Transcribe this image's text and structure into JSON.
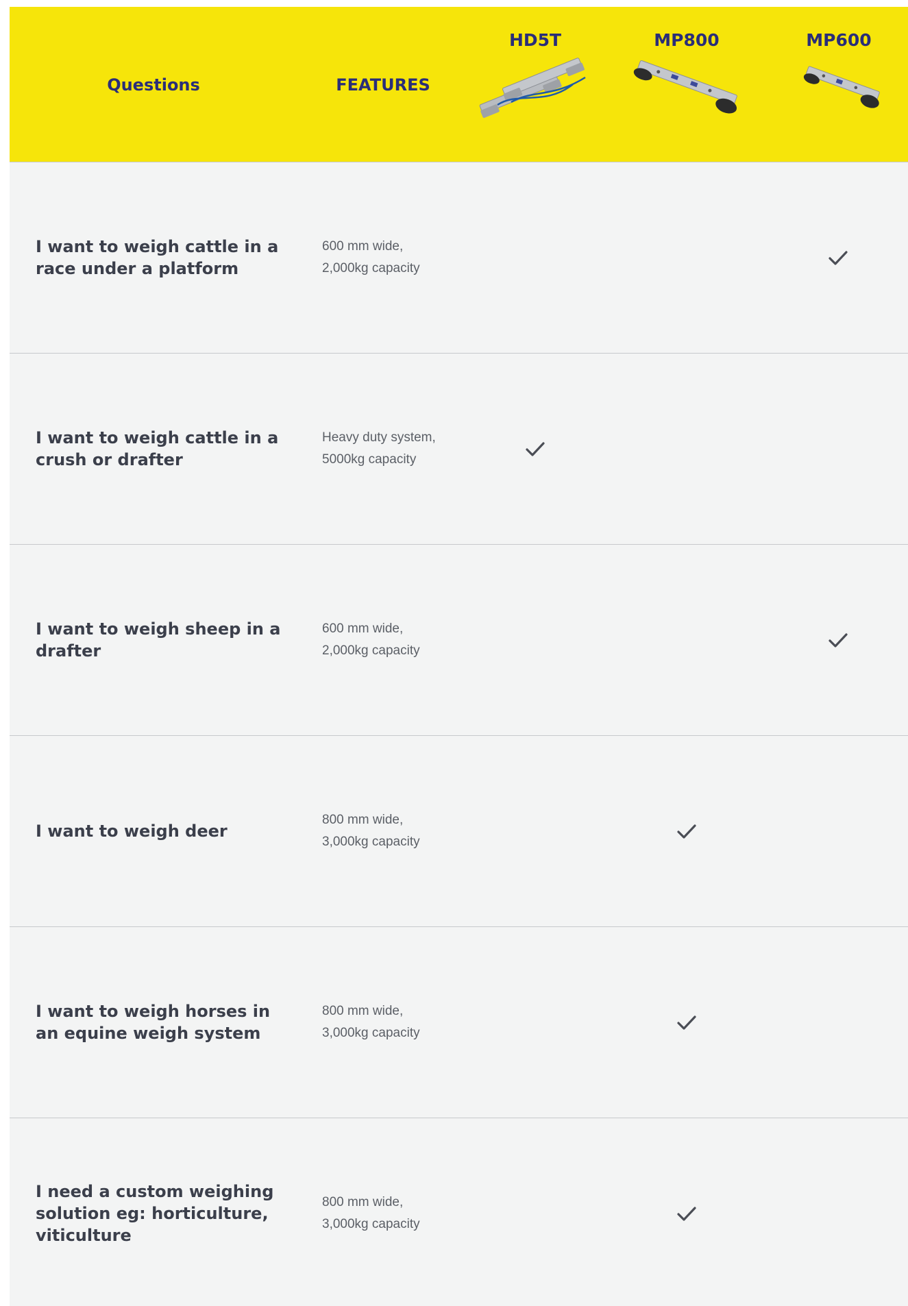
{
  "header": {
    "questions_label": "Questions",
    "features_label": "FEATURES",
    "products": [
      {
        "id": "hd5t",
        "name": "HD5T"
      },
      {
        "id": "mp800",
        "name": "MP800"
      },
      {
        "id": "mp600",
        "name": "MP600"
      }
    ]
  },
  "rows": [
    {
      "question": "I want to weigh cattle in a race under a platform",
      "features": "600 mm wide,\n2,000kg capacity",
      "match": "mp600"
    },
    {
      "question": "I want to weigh cattle in a crush or drafter",
      "features": "Heavy duty system,\n5000kg capacity",
      "match": "hd5t"
    },
    {
      "question": "I want to weigh sheep in a drafter",
      "features": "600 mm wide,\n2,000kg capacity",
      "match": "mp600"
    },
    {
      "question": "I want to weigh deer",
      "features": "800 mm wide,\n3,000kg capacity",
      "match": "mp800"
    },
    {
      "question": "I want to weigh horses in an equine weigh system",
      "features": "800 mm wide,\n3,000kg capacity",
      "match": "mp800"
    },
    {
      "question": "I need a custom weighing solution eg: horticulture, viticulture",
      "features": "800 mm wide,\n3,000kg capacity",
      "match": "mp800"
    }
  ],
  "colors": {
    "header_bg": "#f6e50a",
    "header_text": "#2a2e78",
    "body_bg": "#f3f4f4",
    "check": "#4a4d55"
  },
  "icons": {
    "check": "checkmark-icon",
    "hd5t_image": "load-bars-pair-image",
    "mp800_image": "load-bar-image",
    "mp600_image": "load-bar-image"
  }
}
